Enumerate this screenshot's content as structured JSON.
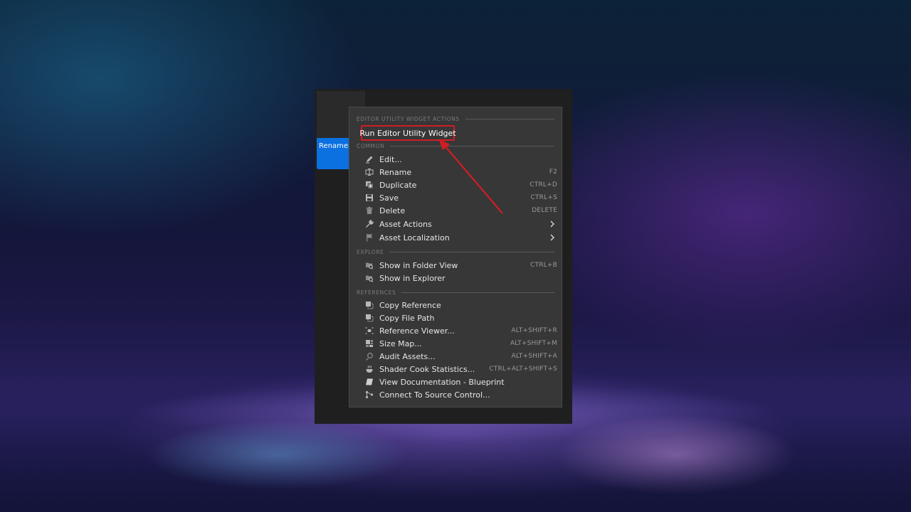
{
  "asset": {
    "label": "Renamer"
  },
  "menu": {
    "sections": {
      "editor_utility": "EDITOR UTILITY WIDGET ACTIONS",
      "common": "COMMON",
      "explore": "EXPLORE",
      "references": "REFERENCES"
    },
    "run_widget": "Run Editor Utility Widget",
    "common_items": [
      {
        "label": "Edit...",
        "shortcut": "",
        "icon": "pencil-icon"
      },
      {
        "label": "Rename",
        "shortcut": "F2",
        "icon": "rename-icon"
      },
      {
        "label": "Duplicate",
        "shortcut": "CTRL+D",
        "icon": "duplicate-icon"
      },
      {
        "label": "Save",
        "shortcut": "CTRL+S",
        "icon": "save-icon"
      },
      {
        "label": "Delete",
        "shortcut": "DELETE",
        "icon": "trash-icon"
      },
      {
        "label": "Asset Actions",
        "shortcut": "",
        "icon": "wrench-icon"
      },
      {
        "label": "Asset Localization",
        "shortcut": "",
        "icon": "flag-icon"
      }
    ],
    "explore_items": [
      {
        "label": "Show in Folder View",
        "shortcut": "CTRL+B",
        "icon": "folder-search-icon"
      },
      {
        "label": "Show in Explorer",
        "shortcut": "",
        "icon": "explorer-icon"
      }
    ],
    "reference_items": [
      {
        "label": "Copy Reference",
        "shortcut": "",
        "icon": "copy-reference-icon"
      },
      {
        "label": "Copy File Path",
        "shortcut": "",
        "icon": "copy-path-icon"
      },
      {
        "label": "Reference Viewer...",
        "shortcut": "ALT+SHIFT+R",
        "icon": "reference-viewer-icon"
      },
      {
        "label": "Size Map...",
        "shortcut": "ALT+SHIFT+M",
        "icon": "size-map-icon"
      },
      {
        "label": "Audit Assets...",
        "shortcut": "ALT+SHIFT+A",
        "icon": "audit-icon"
      },
      {
        "label": "Shader Cook Statistics...",
        "shortcut": "CTRL+ALT+SHIFT+S",
        "icon": "shader-icon"
      },
      {
        "label": "View Documentation - Blueprint",
        "shortcut": "",
        "icon": "documentation-icon"
      },
      {
        "label": "Connect To Source Control...",
        "shortcut": "",
        "icon": "source-control-icon"
      }
    ]
  },
  "colors": {
    "highlight": "#d11d24",
    "asset_blue": "#0b70e0",
    "menu_bg": "#373737"
  }
}
